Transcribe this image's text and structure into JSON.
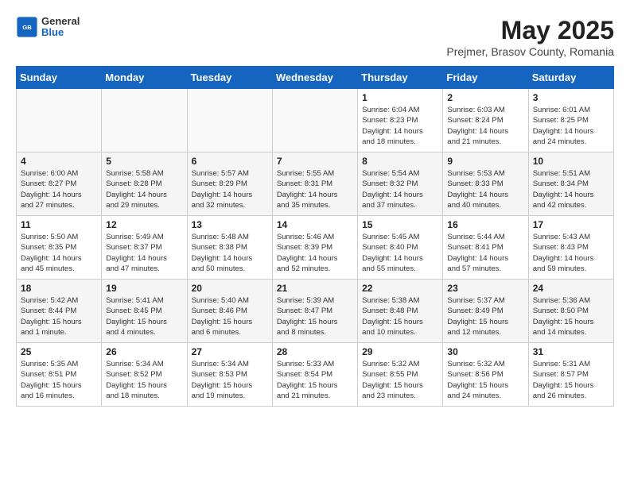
{
  "header": {
    "logo_general": "General",
    "logo_blue": "Blue",
    "month_title": "May 2025",
    "subtitle": "Prejmer, Brasov County, Romania"
  },
  "days_of_week": [
    "Sunday",
    "Monday",
    "Tuesday",
    "Wednesday",
    "Thursday",
    "Friday",
    "Saturday"
  ],
  "weeks": [
    [
      {
        "day": "",
        "info": ""
      },
      {
        "day": "",
        "info": ""
      },
      {
        "day": "",
        "info": ""
      },
      {
        "day": "",
        "info": ""
      },
      {
        "day": "1",
        "info": "Sunrise: 6:04 AM\nSunset: 8:23 PM\nDaylight: 14 hours\nand 18 minutes."
      },
      {
        "day": "2",
        "info": "Sunrise: 6:03 AM\nSunset: 8:24 PM\nDaylight: 14 hours\nand 21 minutes."
      },
      {
        "day": "3",
        "info": "Sunrise: 6:01 AM\nSunset: 8:25 PM\nDaylight: 14 hours\nand 24 minutes."
      }
    ],
    [
      {
        "day": "4",
        "info": "Sunrise: 6:00 AM\nSunset: 8:27 PM\nDaylight: 14 hours\nand 27 minutes."
      },
      {
        "day": "5",
        "info": "Sunrise: 5:58 AM\nSunset: 8:28 PM\nDaylight: 14 hours\nand 29 minutes."
      },
      {
        "day": "6",
        "info": "Sunrise: 5:57 AM\nSunset: 8:29 PM\nDaylight: 14 hours\nand 32 minutes."
      },
      {
        "day": "7",
        "info": "Sunrise: 5:55 AM\nSunset: 8:31 PM\nDaylight: 14 hours\nand 35 minutes."
      },
      {
        "day": "8",
        "info": "Sunrise: 5:54 AM\nSunset: 8:32 PM\nDaylight: 14 hours\nand 37 minutes."
      },
      {
        "day": "9",
        "info": "Sunrise: 5:53 AM\nSunset: 8:33 PM\nDaylight: 14 hours\nand 40 minutes."
      },
      {
        "day": "10",
        "info": "Sunrise: 5:51 AM\nSunset: 8:34 PM\nDaylight: 14 hours\nand 42 minutes."
      }
    ],
    [
      {
        "day": "11",
        "info": "Sunrise: 5:50 AM\nSunset: 8:35 PM\nDaylight: 14 hours\nand 45 minutes."
      },
      {
        "day": "12",
        "info": "Sunrise: 5:49 AM\nSunset: 8:37 PM\nDaylight: 14 hours\nand 47 minutes."
      },
      {
        "day": "13",
        "info": "Sunrise: 5:48 AM\nSunset: 8:38 PM\nDaylight: 14 hours\nand 50 minutes."
      },
      {
        "day": "14",
        "info": "Sunrise: 5:46 AM\nSunset: 8:39 PM\nDaylight: 14 hours\nand 52 minutes."
      },
      {
        "day": "15",
        "info": "Sunrise: 5:45 AM\nSunset: 8:40 PM\nDaylight: 14 hours\nand 55 minutes."
      },
      {
        "day": "16",
        "info": "Sunrise: 5:44 AM\nSunset: 8:41 PM\nDaylight: 14 hours\nand 57 minutes."
      },
      {
        "day": "17",
        "info": "Sunrise: 5:43 AM\nSunset: 8:43 PM\nDaylight: 14 hours\nand 59 minutes."
      }
    ],
    [
      {
        "day": "18",
        "info": "Sunrise: 5:42 AM\nSunset: 8:44 PM\nDaylight: 15 hours\nand 1 minute."
      },
      {
        "day": "19",
        "info": "Sunrise: 5:41 AM\nSunset: 8:45 PM\nDaylight: 15 hours\nand 4 minutes."
      },
      {
        "day": "20",
        "info": "Sunrise: 5:40 AM\nSunset: 8:46 PM\nDaylight: 15 hours\nand 6 minutes."
      },
      {
        "day": "21",
        "info": "Sunrise: 5:39 AM\nSunset: 8:47 PM\nDaylight: 15 hours\nand 8 minutes."
      },
      {
        "day": "22",
        "info": "Sunrise: 5:38 AM\nSunset: 8:48 PM\nDaylight: 15 hours\nand 10 minutes."
      },
      {
        "day": "23",
        "info": "Sunrise: 5:37 AM\nSunset: 8:49 PM\nDaylight: 15 hours\nand 12 minutes."
      },
      {
        "day": "24",
        "info": "Sunrise: 5:36 AM\nSunset: 8:50 PM\nDaylight: 15 hours\nand 14 minutes."
      }
    ],
    [
      {
        "day": "25",
        "info": "Sunrise: 5:35 AM\nSunset: 8:51 PM\nDaylight: 15 hours\nand 16 minutes."
      },
      {
        "day": "26",
        "info": "Sunrise: 5:34 AM\nSunset: 8:52 PM\nDaylight: 15 hours\nand 18 minutes."
      },
      {
        "day": "27",
        "info": "Sunrise: 5:34 AM\nSunset: 8:53 PM\nDaylight: 15 hours\nand 19 minutes."
      },
      {
        "day": "28",
        "info": "Sunrise: 5:33 AM\nSunset: 8:54 PM\nDaylight: 15 hours\nand 21 minutes."
      },
      {
        "day": "29",
        "info": "Sunrise: 5:32 AM\nSunset: 8:55 PM\nDaylight: 15 hours\nand 23 minutes."
      },
      {
        "day": "30",
        "info": "Sunrise: 5:32 AM\nSunset: 8:56 PM\nDaylight: 15 hours\nand 24 minutes."
      },
      {
        "day": "31",
        "info": "Sunrise: 5:31 AM\nSunset: 8:57 PM\nDaylight: 15 hours\nand 26 minutes."
      }
    ]
  ]
}
